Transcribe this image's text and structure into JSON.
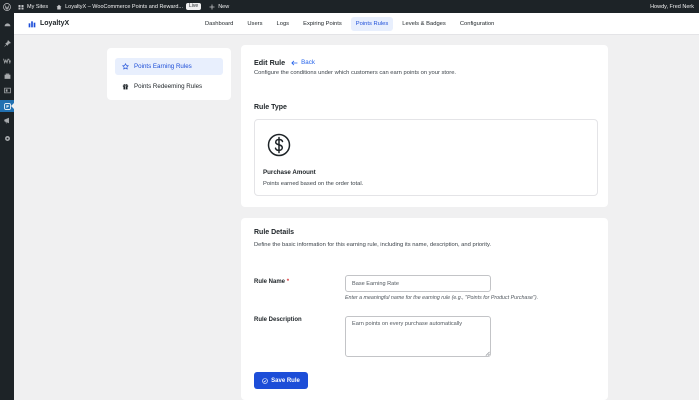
{
  "adminbar": {
    "my_sites": "My Sites",
    "site_name": "LoyaltyX – WooCommerce Points and Reward...",
    "live_badge": "Live",
    "new_label": "New",
    "howdy": "Howdy, Fred Nerk"
  },
  "header": {
    "brand": "LoyaltyX",
    "nav": [
      {
        "label": "Dashboard"
      },
      {
        "label": "Users"
      },
      {
        "label": "Logs"
      },
      {
        "label": "Expiring Points"
      },
      {
        "label": "Points Rules"
      },
      {
        "label": "Levels & Badges"
      },
      {
        "label": "Configuration"
      }
    ],
    "active_nav": "Points Rules"
  },
  "rules_nav": {
    "items": [
      {
        "label": "Points Earning Rules"
      },
      {
        "label": "Points Redeeming Rules"
      }
    ],
    "active": "Points Earning Rules"
  },
  "edit": {
    "title": "Edit Rule",
    "back_label": "Back",
    "description": "Configure the conditions under which customers can earn points on your store."
  },
  "rule_type": {
    "section_title": "Rule Type",
    "name": "Purchase Amount",
    "description": "Points earned based on the order total."
  },
  "rule_details": {
    "section_title": "Rule Details",
    "description": "Define the basic information for this earning rule, including its name, description, and priority.",
    "name_label": "Rule Name",
    "required_mark": "*",
    "name_value": "Base Earning Rate",
    "name_hint": "Enter a meaningful name for the earning rule (e.g., \"Points for Product Purchase\").",
    "desc_label": "Rule Description",
    "desc_value": "Earn points on every purchase automatically",
    "save_label": "Save Rule"
  },
  "colors": {
    "accent": "#1d4ed8",
    "accent_light": "#e8effd",
    "admin_dark": "#1d2327",
    "page_bg": "#f0f0f1"
  }
}
